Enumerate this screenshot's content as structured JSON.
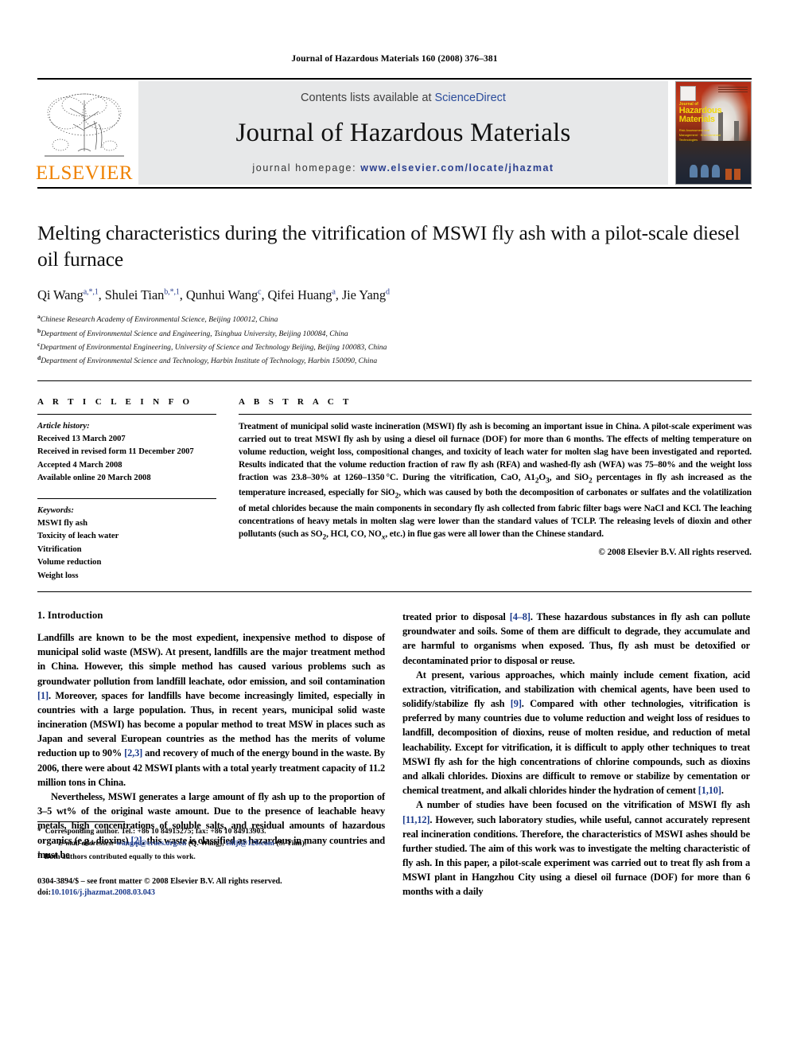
{
  "running_head": "Journal of Hazardous Materials 160 (2008) 376–381",
  "masthead": {
    "publisher_wordmark": "ELSEVIER",
    "contents_prefix": "Contents lists available at ",
    "contents_link": "ScienceDirect",
    "journal_title": "Journal of Hazardous Materials",
    "homepage_label": "journal homepage:",
    "homepage_url": "www.elsevier.com/locate/jhazmat",
    "cover": {
      "journal_small": "Journal of",
      "journal_line1": "Hazardous",
      "journal_line2": "Materials",
      "journal_sub": "Risk Assessment and Management · Environmental Technologies"
    },
    "accent_orange": "#ef8200",
    "link_blue": "#2b4c9b",
    "band_gray": "#e7e8e9"
  },
  "title": "Melting characteristics during the vitrification of MSWI fly ash with a pilot-scale diesel oil furnace",
  "authors_html": "Qi Wang<sup>a,*,1</sup>, Shulei Tian<sup>b,*,1</sup>, Qunhui Wang<sup>c</sup>, Qifei Huang<sup>a</sup>, Jie Yang<sup>d</sup>",
  "affiliations": [
    {
      "mark": "a",
      "text": "Chinese Research Academy of Environmental Science, Beijing 100012, China"
    },
    {
      "mark": "b",
      "text": "Department of Environmental Science and Engineering, Tsinghua University, Beijing 100084, China"
    },
    {
      "mark": "c",
      "text": "Department of Environmental Engineering, University of Science and Technology Beijing, Beijing 100083, China"
    },
    {
      "mark": "d",
      "text": "Department of Environmental Science and Technology, Harbin Institute of Technology, Harbin 150090, China"
    }
  ],
  "article_info": {
    "heading": "A R T I C L E    I N F O",
    "history_label": "Article history:",
    "history": [
      "Received 13 March 2007",
      "Received in revised form 11 December 2007",
      "Accepted 4 March 2008",
      "Available online 20 March 2008"
    ],
    "keywords_label": "Keywords:",
    "keywords": [
      "MSWI fly ash",
      "Toxicity of leach water",
      "Vitrification",
      "Volume reduction",
      "Weight loss"
    ]
  },
  "abstract": {
    "heading": "A B S T R A C T",
    "body_html": "Treatment of municipal solid waste incineration (MSWI) fly ash is becoming an important issue in China. A pilot-scale experiment was carried out to treat MSWI fly ash by using a diesel oil furnace (DOF) for more than 6 months. The effects of melting temperature on volume reduction, weight loss, compositional changes, and toxicity of leach water for molten slag have been investigated and reported. Results indicated that the volume reduction fraction of raw fly ash (RFA) and washed-fly ash (WFA) was 75–80% and the weight loss fraction was 23.8–30% at 1260–1350&#8201;°C. During the vitrification, CaO, A1<sub>2</sub>O<sub>3</sub>, and SiO<sub>2</sub> percentages in fly ash increased as the temperature increased, especially for SiO<sub>2</sub>, which was caused by both the decomposition of carbonates or sulfates and the volatilization of metal chlorides because the main components in secondary fly ash collected from fabric filter bags were NaCl and KCl. The leaching concentrations of heavy metals in molten slag were lower than the standard values of TCLP. The releasing levels of dioxin and other pollutants (such as SO<sub>2</sub>, HCl, CO, NO<sub><i>x</i></sub>, etc.) in flue gas were all lower than the Chinese standard.",
    "copyright": "© 2008 Elsevier B.V. All rights reserved."
  },
  "body": {
    "section_heading": "1.  Introduction",
    "left_paragraphs_html": [
      "Landfills are known to be the most expedient, inexpensive method to dispose of municipal solid waste (MSW). At present, landfills are the major treatment method in China. However, this simple method has caused various problems such as groundwater pollution from landfill leachate, odor emission, and soil contamination <span class=\"ref\">[1]</span>. Moreover, spaces for landfills have become increasingly limited, especially in countries with a large population. Thus, in recent years, municipal solid waste incineration (MSWI) has become a popular method to treat MSW in places such as Japan and several European countries as the method has the merits of volume reduction up to 90% <span class=\"ref\">[2,3]</span> and recovery of much of the energy bound in the waste. By 2006, there were about 42 MSWI plants with a total yearly treatment capacity of 11.2 million tons in China.",
      "Nevertheless, MSWI generates a large amount of fly ash up to the proportion of 3–5 wt% of the original waste amount. Due to the presence of leachable heavy metals, high concentrations of soluble salts, and residual amounts of hazardous organics (e.g., dioxins) <span class=\"ref\">[2]</span>, this waste is classified as hazardous in many countries and must be"
    ],
    "right_paragraphs_html": [
      "treated prior to disposal <span class=\"ref\">[4–8]</span>. These hazardous substances in fly ash can pollute groundwater and soils. Some of them are difficult to degrade, they accumulate and are harmful to organisms when exposed. Thus, fly ash must be detoxified or decontaminated prior to disposal or reuse.",
      "At present, various approaches, which mainly include cement fixation, acid extraction, vitrification, and stabilization with chemical agents, have been used to solidify/stabilize fly ash <span class=\"ref\">[9]</span>. Compared with other technologies, vitrification is preferred by many countries due to volume reduction and weight loss of residues to landfill, decomposition of dioxins, reuse of molten residue, and reduction of metal leachability. Except for vitrification, it is difficult to apply other techniques to treat MSWI fly ash for the high concentrations of chlorine compounds, such as dioxins and alkali chlorides. Dioxins are difficult to remove or stabilize by cementation or chemical treatment, and alkali chlorides hinder the hydration of cement <span class=\"ref\">[1,10]</span>.",
      "A number of studies have been focused on the vitrification of MSWI fly ash <span class=\"ref\">[11,12]</span>. However, such laboratory studies, while useful, cannot accurately represent real incineration conditions. Therefore, the characteristics of MSWI ashes should be further studied. The aim of this work was to investigate the melting characteristic of fly ash. In this paper, a pilot-scale experiment was carried out to treat fly ash from a MSWI plant in Hangzhou City using a diesel oil furnace (DOF) for more than 6 months with a daily"
    ]
  },
  "footnotes": {
    "corresponding_html": "<span class=\"mark\">*</span>&nbsp; Corresponding author. Tel.: +86 10 84915275; fax: +86 10 84913903.",
    "emails_html": "<em>E-mail addresses:</em> <span class=\"mail\">wangqi@craes.org.cn</span> (Q. Wang), <span class=\"mail\">tsllji@126.com</span> (S. Tian).",
    "equal_html": "<span class=\"mark\"><sup>1</sup></span>&nbsp; Both authors contributed equally to this work.",
    "imprint_line1": "0304-3894/$ – see front matter © 2008 Elsevier B.V. All rights reserved.",
    "imprint_doi_label": "doi:",
    "imprint_doi": "10.1016/j.jhazmat.2008.03.043"
  }
}
